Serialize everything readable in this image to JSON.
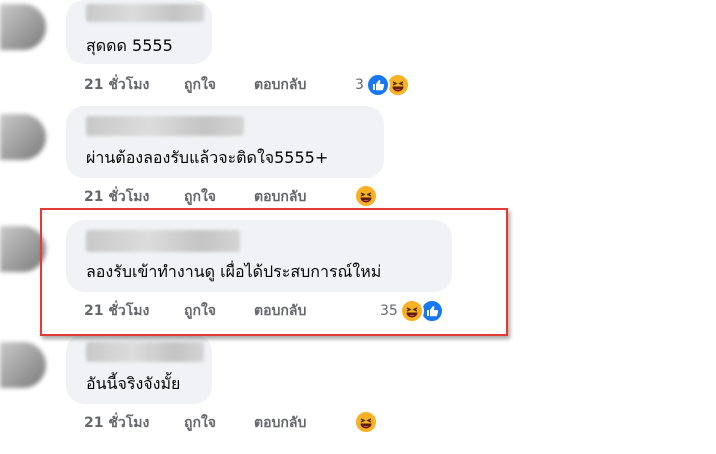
{
  "comments": [
    {
      "text": "สุดดด 5555",
      "time": "21 ชั่วโมง",
      "like_label": "ถูกใจ",
      "reply_label": "ตอบกลับ",
      "reaction_count": "3",
      "reactions": [
        "like-icon",
        "haha-icon"
      ]
    },
    {
      "text": "ผ่านต้องลองรับแล้วจะติดใจ5555+",
      "time": "21 ชั่วโมง",
      "like_label": "ถูกใจ",
      "reply_label": "ตอบกลับ",
      "reaction_count": "",
      "reactions": [
        "haha-icon"
      ]
    },
    {
      "text": "ลองรับเข้าทำงานดู เผื่อได้ประสบการณ์ใหม่",
      "time": "21 ชั่วโมง",
      "like_label": "ถูกใจ",
      "reply_label": "ตอบกลับ",
      "reaction_count": "35",
      "reactions": [
        "haha-icon",
        "like-icon"
      ]
    },
    {
      "text": "อันนี้จริงจังมั้ย",
      "time": "21 ชั่วโมง",
      "like_label": "ถูกใจ",
      "reply_label": "ตอบกลับ",
      "reaction_count": "",
      "reactions": [
        "haha-icon"
      ]
    }
  ],
  "colors": {
    "bubble": "#f0f2f5",
    "action_text": "#65676b",
    "like_blue": "#1877f2",
    "haha_yellow": "#f7b125",
    "highlight_red": "#e53935"
  }
}
